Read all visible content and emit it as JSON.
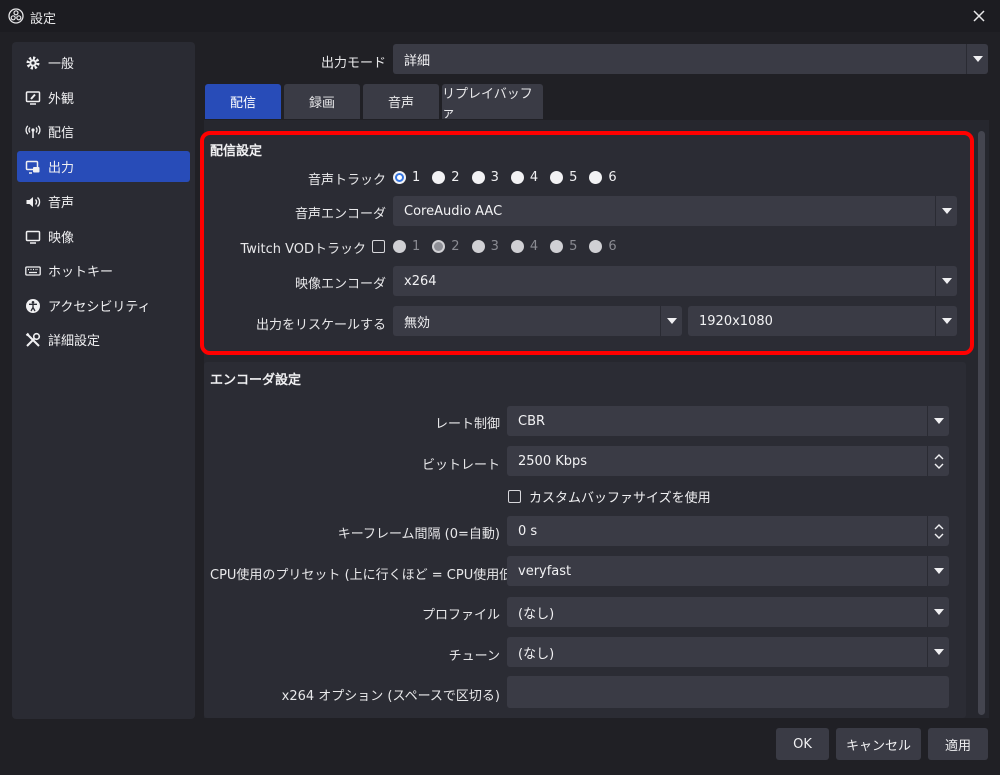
{
  "window": {
    "title": "設定"
  },
  "sidebar": {
    "items": [
      {
        "label": "一般",
        "icon": "gear-icon"
      },
      {
        "label": "外観",
        "icon": "appearance-icon"
      },
      {
        "label": "配信",
        "icon": "broadcast-icon"
      },
      {
        "label": "出力",
        "icon": "output-icon",
        "active": true
      },
      {
        "label": "音声",
        "icon": "speaker-icon"
      },
      {
        "label": "映像",
        "icon": "monitor-icon"
      },
      {
        "label": "ホットキー",
        "icon": "keyboard-icon"
      },
      {
        "label": "アクセシビリティ",
        "icon": "accessibility-icon"
      },
      {
        "label": "詳細設定",
        "icon": "tools-icon"
      }
    ]
  },
  "output_mode": {
    "label": "出力モード",
    "value": "詳細"
  },
  "tabs": [
    {
      "label": "配信",
      "active": true
    },
    {
      "label": "録画"
    },
    {
      "label": "音声"
    },
    {
      "label": "リプレイバッファ"
    }
  ],
  "streaming": {
    "title": "配信設定",
    "audio_track_label": "音声トラック",
    "audio_tracks": [
      "1",
      "2",
      "3",
      "4",
      "5",
      "6"
    ],
    "audio_track_selected": "1",
    "audio_encoder_label": "音声エンコーダ",
    "audio_encoder_value": "CoreAudio AAC",
    "vod_label": "Twitch VODトラック",
    "vod_tracks": [
      "1",
      "2",
      "3",
      "4",
      "5",
      "6"
    ],
    "vod_selected": "2",
    "video_encoder_label": "映像エンコーダ",
    "video_encoder_value": "x264",
    "rescale_label": "出力をリスケールする",
    "rescale_value": "無効",
    "rescale_resolution": "1920x1080"
  },
  "encoder": {
    "title": "エンコーダ設定",
    "rate_control_label": "レート制御",
    "rate_control_value": "CBR",
    "bitrate_label": "ビットレート",
    "bitrate_value": "2500 Kbps",
    "custom_buffer_label": "カスタムバッファサイズを使用",
    "keyframe_label": "キーフレーム間隔 (0=自動)",
    "keyframe_value": "0 s",
    "preset_label": "CPU使用のプリセット (上に行くほど = CPU使用低い)",
    "preset_value": "veryfast",
    "profile_label": "プロファイル",
    "profile_value": "(なし)",
    "tune_label": "チューン",
    "tune_value": "(なし)",
    "options_label": "x264 オプション (スペースで区切る)",
    "options_value": ""
  },
  "buttons": {
    "ok": "OK",
    "cancel": "キャンセル",
    "apply": "適用"
  },
  "colors": {
    "accent": "#284cb8",
    "highlight_border": "#ff0000",
    "background": "#202025"
  }
}
